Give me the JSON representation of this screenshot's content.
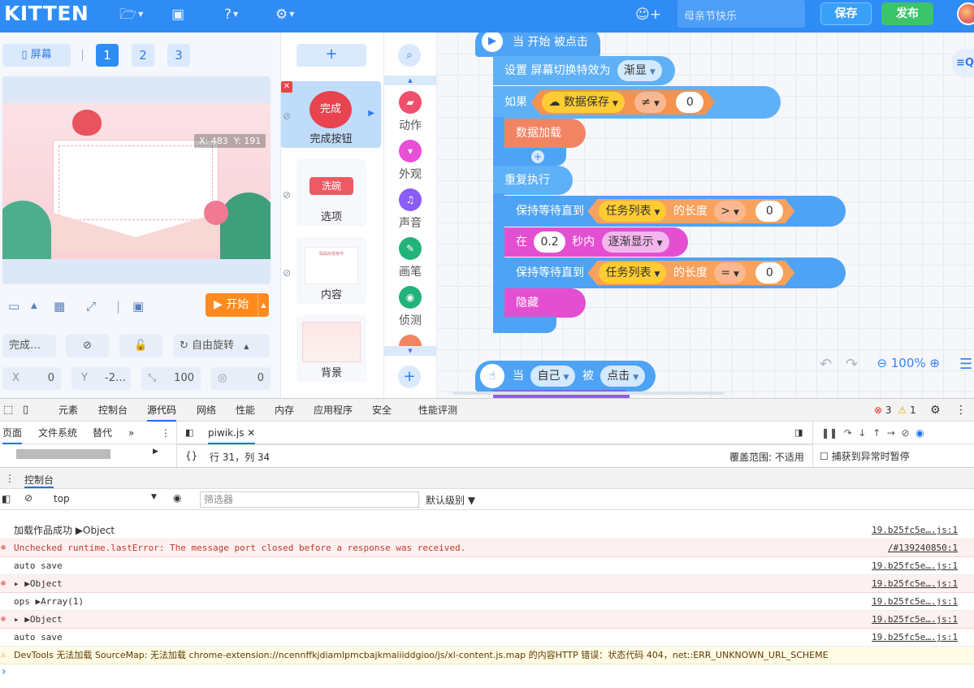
{
  "topbar": {
    "brand": "KITTEN",
    "icons": [
      "folder-icon",
      "briefcase-icon",
      "help-icon",
      "gear-icon"
    ],
    "add_user_icon": "add-user-icon",
    "project_name": "母亲节快乐",
    "save_label": "保存",
    "publish_label": "发布"
  },
  "stage_panel": {
    "screen_label": "屏幕",
    "pages": [
      "1",
      "2",
      "3"
    ],
    "active_page": "1",
    "coords": {
      "x_label": "X: 483",
      "y_label": "Y: 191"
    },
    "start_label": "开始",
    "sprite_name_field": "完成…",
    "rotation_label": "自由旋转",
    "x_label": "X",
    "x_value": "0",
    "y_label": "Y",
    "y_value": "-2…",
    "size_value": "100",
    "direction_value": "0"
  },
  "sprites": {
    "add_label": "+",
    "items": [
      {
        "label": "完成按钮",
        "thumb": "完成",
        "selected": true
      },
      {
        "label": "选项",
        "thumb": "洗碗"
      },
      {
        "label": "内容",
        "thumb": "妈妈的母亲节"
      },
      {
        "label": "背景"
      }
    ]
  },
  "categories": [
    {
      "label": "动作",
      "color": "#f0506e",
      "icon": "motion-icon"
    },
    {
      "label": "外观",
      "color": "#e84fd6",
      "icon": "looks-icon"
    },
    {
      "label": "声音",
      "color": "#8b5cf6",
      "icon": "sound-icon"
    },
    {
      "label": "画笔",
      "color": "#22b37a",
      "icon": "pen-icon"
    },
    {
      "label": "侦测",
      "color": "#22b37a",
      "icon": "sensing-icon"
    }
  ],
  "script": {
    "hat1": "当 开始 被点击",
    "b1_text": "设置 屏幕切换特效为",
    "b1_dd": "渐显",
    "if_label": "如果",
    "if_var": "数据保存",
    "if_op": "≠",
    "if_value": "0",
    "load_label": "数据加载",
    "repeat_label": "重复执行",
    "wait1_label": "保持等待直到",
    "wait1_list": "任务列表",
    "wait1_len": "的长度",
    "wait1_op": ">",
    "wait1_value": "0",
    "in_label": "在",
    "in_value": "0.2",
    "in_unit": "秒内",
    "in_effect": "逐渐显示",
    "wait2_label": "保持等待直到",
    "wait2_list": "任务列表",
    "wait2_len": "的长度",
    "wait2_op": "=",
    "wait2_value": "0",
    "hide_label": "隐藏",
    "hat2_when": "当",
    "hat2_self": "自己",
    "hat2_by": "被",
    "hat2_click": "点击",
    "zoom": "100%"
  },
  "devtools": {
    "tabs": [
      "元素",
      "控制台",
      "源代码",
      "网络",
      "性能",
      "内存",
      "应用程序",
      "安全",
      "性能评测"
    ],
    "active_tab": "源代码",
    "errors": "3",
    "warnings": "1",
    "left_tabs": [
      "页面",
      "文件系统",
      "替代"
    ],
    "file": "piwik.js",
    "position": "行 31，列 34",
    "coverage": "覆盖范围: 不适用",
    "pause_exceptions": "捕获到异常时暂停",
    "console_title": "控制台",
    "context": "top",
    "filter_placeholder": "筛选器",
    "level": "默认级别",
    "logs": [
      {
        "type": "plain",
        "text": "加载作品成功 ▶Object",
        "src": "19.b25fc5e….js:1"
      },
      {
        "type": "err",
        "text": "Unchecked runtime.lastError: The message port closed before a response was received.",
        "src": "/#139240850:1"
      },
      {
        "type": "plain",
        "text": "auto save",
        "src": "19.b25fc5e….js:1"
      },
      {
        "type": "err",
        "text": "▸ ▶Object",
        "src": "19.b25fc5e….js:1"
      },
      {
        "type": "plain",
        "text": "ops ▶Array(1)",
        "src": "19.b25fc5e….js:1"
      },
      {
        "type": "err",
        "text": "▸ ▶Object",
        "src": "19.b25fc5e….js:1"
      },
      {
        "type": "plain",
        "text": "auto save",
        "src": "19.b25fc5e….js:1"
      },
      {
        "type": "warn",
        "text": "DevTools 无法加载 SourceMap: 无法加载 chrome-extension://ncennffkjdiamlpmcbajkmaiiiddgioo/js/xl-content.js.map 的内容HTTP 错误：状态代码 404，net::ERR_UNKNOWN_URL_SCHEME",
        "src": ""
      }
    ]
  }
}
